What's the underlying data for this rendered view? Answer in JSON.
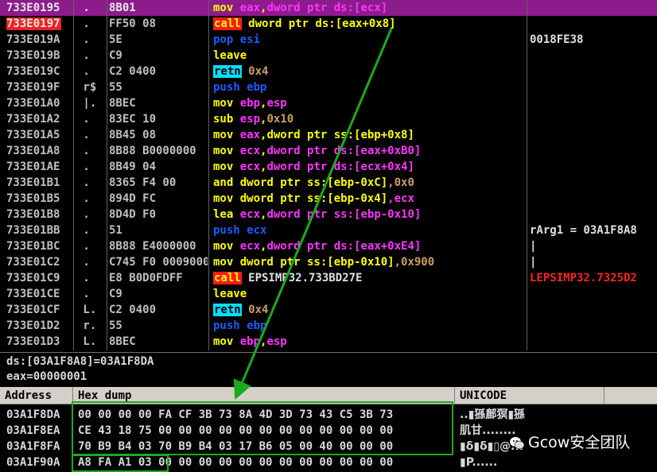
{
  "disasm": {
    "rows": [
      {
        "addr": "733E0195",
        "mark": ".",
        "hex": "8B01",
        "ins": [
          [
            "mov ",
            "t-mov"
          ],
          [
            "eax",
            "t-reg"
          ],
          [
            ",",
            "t-mov"
          ],
          [
            "dword ptr ds:[",
            "t-reg"
          ],
          [
            "ecx",
            "t-reg"
          ],
          [
            "]",
            "t-reg"
          ]
        ],
        "comment": "",
        "selected": true
      },
      {
        "addr": "733E0197",
        "mark": ".",
        "hex": "FF50 08",
        "ins": [
          [
            "call",
            "t-call"
          ],
          [
            " dword ptr ds:[eax+0x8]",
            "t-yel"
          ]
        ],
        "comment": "",
        "addr_hl": true
      },
      {
        "addr": "733E019A",
        "mark": ".",
        "hex": "5E",
        "ins": [
          [
            "pop ",
            "t-push"
          ],
          [
            "esi",
            "t-push"
          ]
        ],
        "comment": "0018FE38"
      },
      {
        "addr": "733E019B",
        "mark": ".",
        "hex": "C9",
        "ins": [
          [
            "leave",
            "t-yel"
          ]
        ],
        "comment": ""
      },
      {
        "addr": "733E019C",
        "mark": ".",
        "hex": "C2 0400",
        "ins": [
          [
            "retn",
            "t-ret"
          ],
          [
            " 0x4",
            "t-num"
          ]
        ],
        "comment": ""
      },
      {
        "addr": "733E019F",
        "mark": "r$",
        "hex": "55",
        "ins": [
          [
            "push ",
            "t-push"
          ],
          [
            "ebp",
            "t-push"
          ]
        ],
        "comment": ""
      },
      {
        "addr": "733E01A0",
        "mark": "|.",
        "hex": "8BEC",
        "ins": [
          [
            "mov ",
            "t-mov"
          ],
          [
            "ebp",
            "t-reg"
          ],
          [
            ",",
            "t-mov"
          ],
          [
            "esp",
            "t-reg"
          ]
        ],
        "comment": ""
      },
      {
        "addr": "733E01A2",
        "mark": ".",
        "hex": "83EC 10",
        "ins": [
          [
            "sub ",
            "t-mov"
          ],
          [
            "esp",
            "t-reg"
          ],
          [
            ",",
            "t-mov"
          ],
          [
            "0x10",
            "t-num"
          ]
        ],
        "comment": ""
      },
      {
        "addr": "733E01A5",
        "mark": ".",
        "hex": "8B45 08",
        "ins": [
          [
            "mov ",
            "t-mov"
          ],
          [
            "eax",
            "t-reg"
          ],
          [
            ",dword ptr ss:[ebp+0x8]",
            "t-mov"
          ]
        ],
        "comment": ""
      },
      {
        "addr": "733E01A8",
        "mark": ".",
        "hex": "8B88 B0000000",
        "ins": [
          [
            "mov ",
            "t-mov"
          ],
          [
            "ecx",
            "t-reg"
          ],
          [
            ",",
            "t-mov"
          ],
          [
            "dword ptr ds:[eax+0xB0]",
            "t-reg"
          ]
        ],
        "comment": ""
      },
      {
        "addr": "733E01AE",
        "mark": ".",
        "hex": "8B49 04",
        "ins": [
          [
            "mov ",
            "t-mov"
          ],
          [
            "ecx",
            "t-reg"
          ],
          [
            ",",
            "t-mov"
          ],
          [
            "dword ptr ds:[ecx+0x4]",
            "t-reg"
          ]
        ],
        "comment": ""
      },
      {
        "addr": "733E01B1",
        "mark": ".",
        "hex": "8365 F4 00",
        "ins": [
          [
            "and ",
            "t-mov"
          ],
          [
            "dword ptr ss:[ebp-0xC]",
            "t-mov"
          ],
          [
            ",0x0",
            "t-num"
          ]
        ],
        "comment": ""
      },
      {
        "addr": "733E01B5",
        "mark": ".",
        "hex": "894D FC",
        "ins": [
          [
            "mov ",
            "t-mov"
          ],
          [
            "dword ptr ss:[ebp-0x4]",
            "t-mov"
          ],
          [
            ",ecx",
            "t-reg"
          ]
        ],
        "comment": ""
      },
      {
        "addr": "733E01B8",
        "mark": ".",
        "hex": "8D4D F0",
        "ins": [
          [
            "lea ",
            "t-mov"
          ],
          [
            "ecx",
            "t-reg"
          ],
          [
            ",",
            "t-mov"
          ],
          [
            "dword ptr ss:[ebp-0x10]",
            "t-reg"
          ]
        ],
        "comment": ""
      },
      {
        "addr": "733E01BB",
        "mark": ".",
        "hex": "51",
        "ins": [
          [
            "push ",
            "t-push"
          ],
          [
            "ecx",
            "t-push"
          ]
        ],
        "comment": "rArg1 = 03A1F8A8",
        "comment_class": "t-white"
      },
      {
        "addr": "733E01BC",
        "mark": ".",
        "hex": "8B88 E4000000",
        "ins": [
          [
            "mov ",
            "t-mov"
          ],
          [
            "ecx",
            "t-reg"
          ],
          [
            ",",
            "t-mov"
          ],
          [
            "dword ptr ds:[eax+0xE4]",
            "t-reg"
          ]
        ],
        "comment": "|",
        "comment_class": "t-white"
      },
      {
        "addr": "733E01C2",
        "mark": ".",
        "hex": "C745 F0 0009000",
        "ins": [
          [
            "mov ",
            "t-mov"
          ],
          [
            "dword ptr ss:[ebp-0x10]",
            "t-mov"
          ],
          [
            ",0x900",
            "t-num"
          ]
        ],
        "comment": "|",
        "comment_class": "t-white"
      },
      {
        "addr": "733E01C9",
        "mark": ".",
        "hex": "E8 B0D0FDFF",
        "ins": [
          [
            "call",
            "t-call"
          ],
          [
            " EPSIMP32.733BD27E",
            "t-white"
          ]
        ],
        "comment": "LEPSIMP32.7325D2",
        "comment_class": "t-red"
      },
      {
        "addr": "733E01CE",
        "mark": ".",
        "hex": "C9",
        "ins": [
          [
            "leave",
            "t-yel"
          ]
        ],
        "comment": ""
      },
      {
        "addr": "733E01CF",
        "mark": "L.",
        "hex": "C2 0400",
        "ins": [
          [
            "retn",
            "t-ret"
          ],
          [
            " 0x4",
            "t-num"
          ]
        ],
        "comment": ""
      },
      {
        "addr": "733E01D2",
        "mark": "r.",
        "hex": "55",
        "ins": [
          [
            "push ",
            "t-push"
          ],
          [
            "ebp",
            "t-push"
          ]
        ],
        "comment": ""
      },
      {
        "addr": "733E01D3",
        "mark": "L.",
        "hex": "8BEC",
        "ins": [
          [
            "mov ",
            "t-mov"
          ],
          [
            "ebp",
            "t-reg"
          ],
          [
            ",",
            "t-mov"
          ],
          [
            "esp",
            "t-reg"
          ]
        ],
        "comment": ""
      }
    ]
  },
  "info": {
    "line1": "ds:[03A1F8A8]=03A1F8DA",
    "line2": "eax=00000001"
  },
  "dump": {
    "headers": {
      "address": "Address",
      "hex": "Hex dump",
      "unicode": "UNICODE"
    },
    "rows": [
      {
        "addr": "03A1F8DA",
        "hex": "00 00 00 00 FA CF 3B 73 8A 4D 3D 73 43 C5 3B 73",
        "uni": "..▮猻鄜猽▮猻"
      },
      {
        "addr": "03A1F8EA",
        "hex": "CE 43 18 75 00 00 00 00 00 00 00 00 00 00 00 00",
        "uni": "肌甘........"
      },
      {
        "addr": "03A1F8FA",
        "hex": "70 B9 B4 03 70 B9 B4 03 17 B6 05 00 40 00 00 00",
        "uni": "▮δ▮δ▮▯@..."
      },
      {
        "addr": "03A1F90A",
        "hex": "A8 FA A1 03 00 00 00 00 00 00 00 00 00 00 00 00",
        "uni": "▮P......"
      }
    ]
  },
  "watermark": {
    "text": "Gcow安全团队"
  },
  "colors": {
    "selection": "#8c1c8c",
    "annotation": "#1aaa1a",
    "call_bg": "#ff1a1a",
    "retn_bg": "#00e0ff"
  }
}
